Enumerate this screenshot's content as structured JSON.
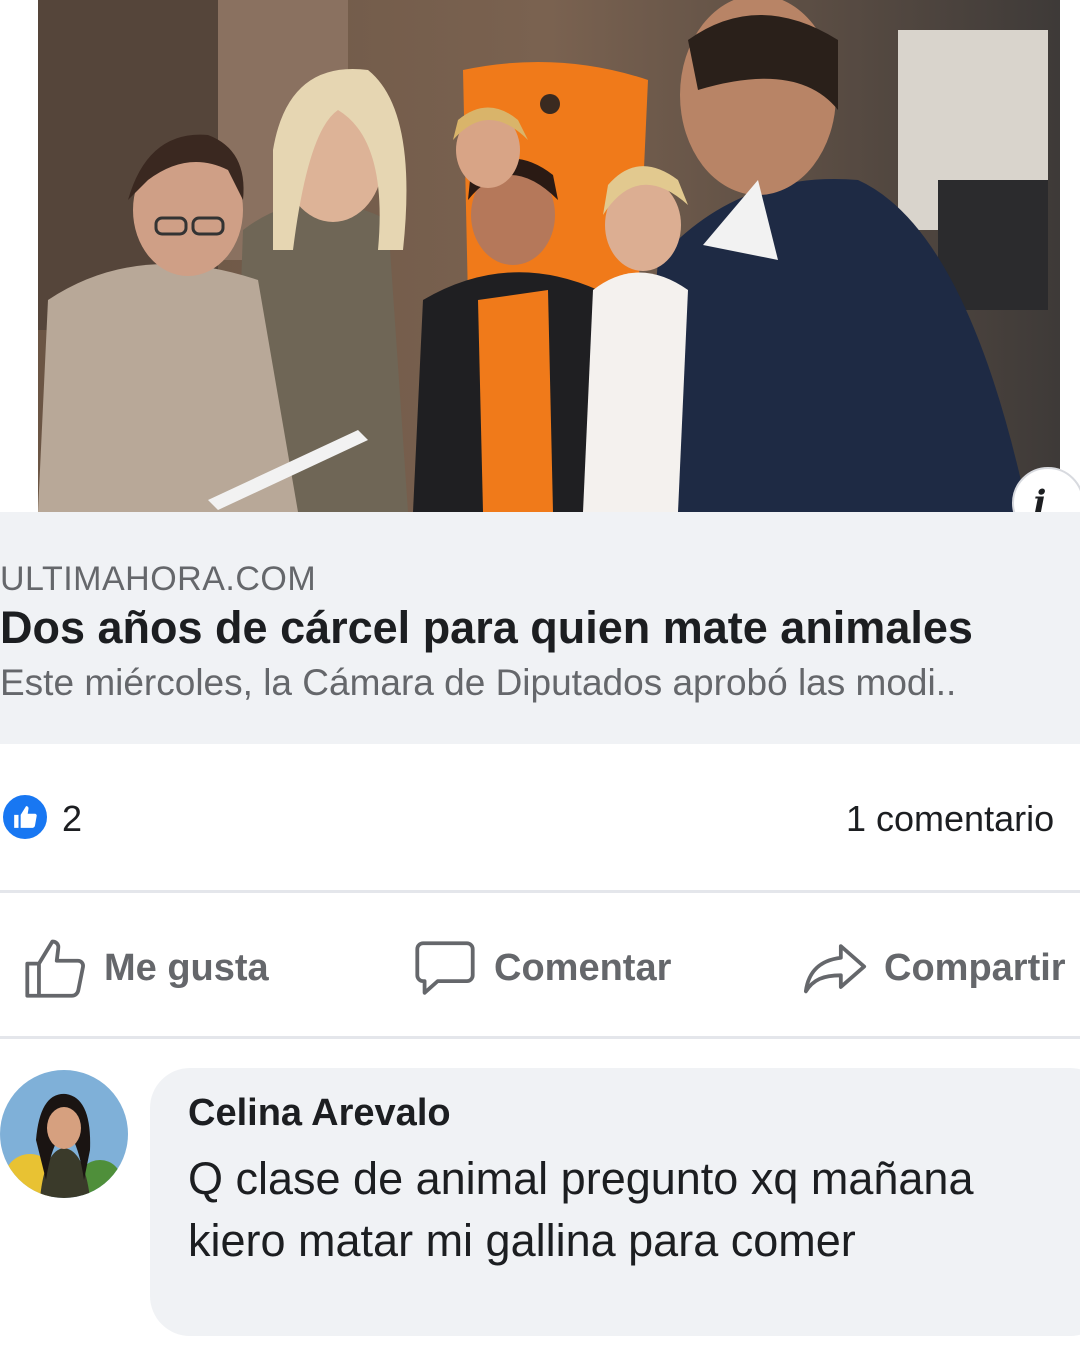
{
  "link_preview": {
    "domain": "ULTIMAHORA.COM",
    "title": "Dos años de cárcel para quien mate animales",
    "description": "Este miércoles, la Cámara de Diputados aprobó las modi..",
    "info_icon": "info-icon"
  },
  "reactions": {
    "like_count": "2",
    "comment_count": "1 comentario",
    "reaction_icon": "thumbs-up-icon"
  },
  "actions": {
    "like_label": "Me gusta",
    "comment_label": "Comentar",
    "share_label": "Compartir"
  },
  "comment": {
    "author": "Celina Arevalo",
    "text": "Q clase de animal pregunto xq mañana kiero matar mi gallina para comer"
  },
  "colors": {
    "accent": "#1877f2",
    "secondary_text": "#65676b",
    "preview_background": "#f0f2f5",
    "shirt_orange": "#f07a1a"
  }
}
